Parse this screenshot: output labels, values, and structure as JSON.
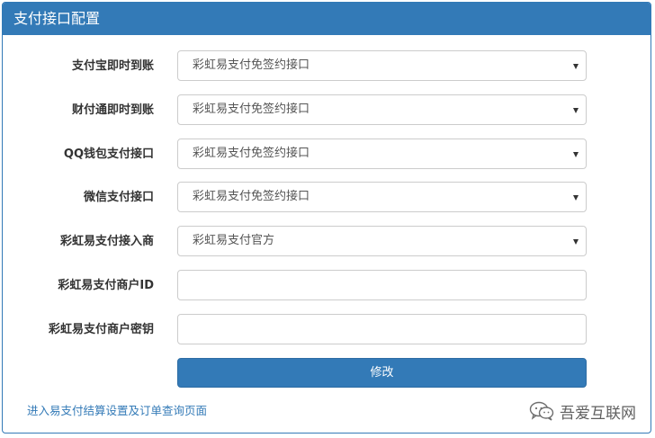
{
  "panel": {
    "title": "支付接口配置"
  },
  "fields": [
    {
      "label": "支付宝即时到账",
      "type": "select",
      "value": "彩虹易支付免签约接口"
    },
    {
      "label": "财付通即时到账",
      "type": "select",
      "value": "彩虹易支付免签约接口"
    },
    {
      "label": "QQ钱包支付接口",
      "type": "select",
      "value": "彩虹易支付免签约接口"
    },
    {
      "label": "微信支付接口",
      "type": "select",
      "value": "彩虹易支付免签约接口"
    },
    {
      "label": "彩虹易支付接入商",
      "type": "select",
      "value": "彩虹易支付官方"
    },
    {
      "label": "彩虹易支付商户ID",
      "type": "text",
      "value": ""
    },
    {
      "label": "彩虹易支付商户密钥",
      "type": "text",
      "value": ""
    }
  ],
  "submit_label": "修改",
  "footer_link": "进入易支付结算设置及订单查询页面",
  "watermark_text": "吾爱互联网",
  "colors": {
    "primary": "#337ab7",
    "border": "#cccccc"
  },
  "icons": {
    "select_caret": "caret-down-icon",
    "watermark_logo": "wechat-logo-icon"
  }
}
